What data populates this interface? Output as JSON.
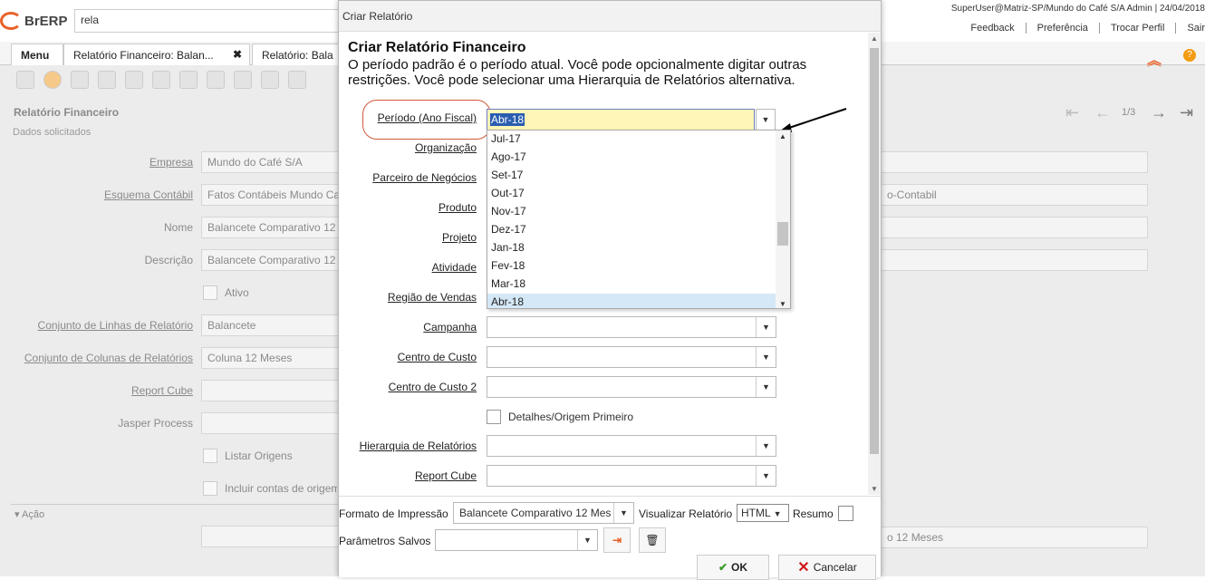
{
  "app": {
    "logo_text": "BrERP",
    "search_value": "rela",
    "user_info": "SuperUser@Matriz-SP/Mundo do Café S/A Admin | 24/04/2018",
    "links": [
      "Feedback",
      "Preferência",
      "Trocar Perfil",
      "Sair"
    ]
  },
  "tabs": [
    {
      "label": "Menu"
    },
    {
      "label": "Relatório Financeiro: Balan..."
    },
    {
      "label": "Relatório: Bala"
    }
  ],
  "background": {
    "section_title": "Relatório Financeiro",
    "subsection": "Dados solicitados",
    "pager": "1/3",
    "acao": "Ação",
    "fields": [
      {
        "label": "Empresa",
        "value": "Mundo do Café S/A"
      },
      {
        "label": "Esquema Contábil",
        "value": "Fatos Contábeis Mundo Ca"
      },
      {
        "label": "Nome",
        "value": "Balancete Comparativo 12"
      },
      {
        "label": "Descrição",
        "value": "Balancete Comparativo 12"
      },
      {
        "label": "Conjunto de Linhas de Relatório",
        "value": "Balancete"
      },
      {
        "label": "Conjunto de Colunas de Relatórios",
        "value": "Coluna 12 Meses"
      },
      {
        "label": "Report Cube",
        "value": ""
      },
      {
        "label": "Jasper Process",
        "value": ""
      }
    ],
    "ativo": "Ativo",
    "listar_origens": "Listar Origens",
    "incluir_contas": "Incluir contas de origem",
    "right_field_esquema": "o-Contabil",
    "right_field_bottom": "o 12 Meses"
  },
  "dialog": {
    "title": "Criar Relatório",
    "heading": "Criar Relatório Financeiro",
    "description": "O período padrão é o período atual. Você pode opcionalmente digitar outras restrições. Você pode selecionar uma Hierarquia de Relatórios alternativa.",
    "periodo_label": "Período (Ano Fiscal)",
    "periodo_value": "Abr-18",
    "dropdown_options": [
      "Jul-17",
      "Ago-17",
      "Set-17",
      "Out-17",
      "Nov-17",
      "Dez-17",
      "Jan-18",
      "Fev-18",
      "Mar-18",
      "Abr-18"
    ],
    "dropdown_selected": "Abr-18",
    "labels": {
      "organizacao": "Organização",
      "parceiro": "Parceiro de Negócios",
      "produto": "Produto",
      "projeto": "Projeto",
      "atividade": "Atividade",
      "regiao": "Região de Vendas",
      "campanha": "Campanha",
      "centro_custo": "Centro de Custo",
      "centro_custo2": "Centro de Custo 2",
      "hierarquia": "Hierarquia de Relatórios",
      "report_cube": "Report Cube"
    },
    "detalhes_label": "Detalhes/Origem Primeiro",
    "footer": {
      "formato_label": "Formato de Impressão",
      "formato_value": "Balancete Comparativo 12 Mes",
      "visualizar_label": "Visualizar Relatório",
      "visualizar_value": "HTML",
      "resumo_label": "Resumo",
      "parametros_label": "Parâmetros Salvos",
      "ok_label": "OK",
      "cancel_label": "Cancelar"
    }
  }
}
